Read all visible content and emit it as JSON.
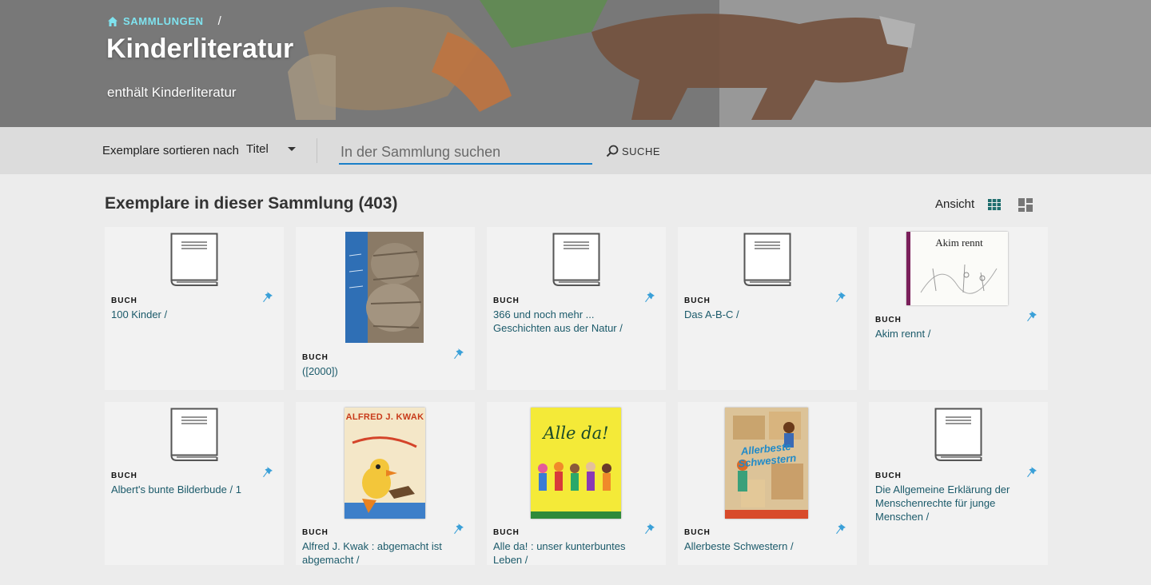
{
  "breadcrumb": {
    "home_label": "SAMMLUNGEN",
    "separator": "/"
  },
  "collection": {
    "title": "Kinderliteratur",
    "description": "enthält Kinderliteratur"
  },
  "toolbar": {
    "sort_label": "Exemplare sortieren nach",
    "sort_value": "Titel",
    "search_placeholder": "In der Sammlung suchen",
    "search_button": "SUCHE"
  },
  "results": {
    "heading": "Exemplare in dieser Sammlung (403)",
    "view_label": "Ansicht"
  },
  "colors": {
    "accent": "#1a7fc8",
    "link": "#1b5a6a",
    "pin": "#3aa0d8",
    "crumb": "#7fe3ef"
  },
  "items": [
    {
      "type": "BUCH",
      "title": "100 Kinder /",
      "cover": "book-icon"
    },
    {
      "type": "BUCH",
      "title": "([2000])",
      "cover": "hedgehog-cover"
    },
    {
      "type": "BUCH",
      "title": "366 und noch mehr ... Geschichten aus der Natur /",
      "cover": "book-icon"
    },
    {
      "type": "BUCH",
      "title": "Das A-B-C /",
      "cover": "book-icon"
    },
    {
      "type": "BUCH",
      "title": "Akim rennt /",
      "cover": "akim-cover",
      "cover_text": "Akim rennt"
    },
    {
      "type": "BUCH",
      "title": "Albert's bunte Bilderbude / 1",
      "cover": "book-icon"
    },
    {
      "type": "BUCH",
      "title": "Alfred J. Kwak : abgemacht ist abgemacht /",
      "cover": "kwak-cover",
      "cover_text": "ALFRED J. KWAK"
    },
    {
      "type": "BUCH",
      "title": "Alle da! : unser kunterbuntes Leben /",
      "cover": "alleda-cover",
      "cover_text": "Alle da!"
    },
    {
      "type": "BUCH",
      "title": "Allerbeste Schwestern /",
      "cover": "schwestern-cover",
      "cover_text": "Allerbeste Schwestern"
    },
    {
      "type": "BUCH",
      "title": "Die Allgemeine Erklärung der Menschenrechte für junge Menschen /",
      "cover": "book-icon"
    }
  ]
}
